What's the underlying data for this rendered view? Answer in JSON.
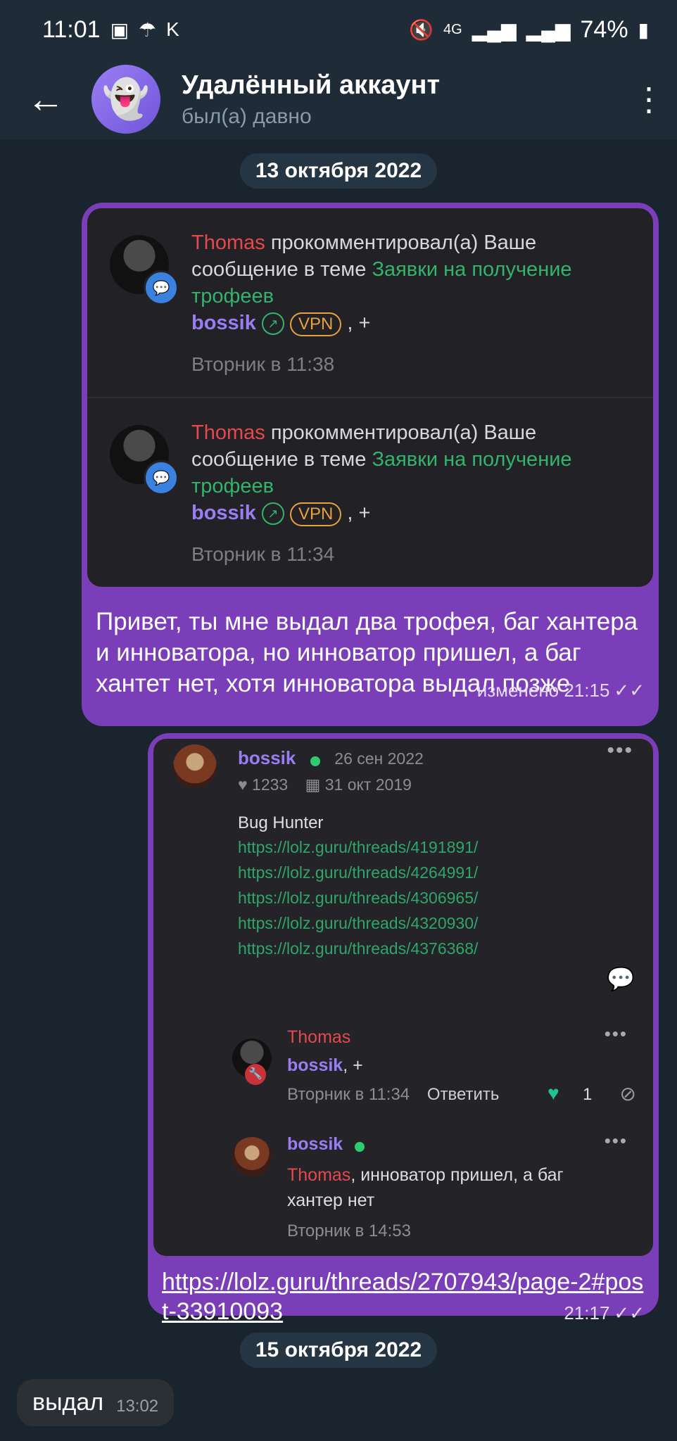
{
  "status_bar": {
    "time": "11:01",
    "left_icons": [
      "image-icon",
      "umbrella-icon",
      "k-icon"
    ],
    "network": "4G",
    "battery": "74%"
  },
  "header": {
    "title": "Удалённый аккаунт",
    "subtitle": "был(а) давно"
  },
  "dates": [
    "13 октября 2022",
    "15 октября 2022"
  ],
  "message1": {
    "notifications": [
      {
        "author": "Thomas",
        "text": "прокомментировал(а) Ваше сообщение в теме",
        "topic": "Заявки на получение трофеев",
        "user": "bossik",
        "badge": "VPN",
        "tail": ", +",
        "time": "Вторник в 11:38"
      },
      {
        "author": "Thomas",
        "text": "прокомментировал(а) Ваше сообщение в теме",
        "topic": "Заявки на получение трофеев",
        "user": "bossik",
        "badge": "VPN",
        "tail": ", +",
        "time": "Вторник в 11:34"
      }
    ],
    "text": "Привет, ты мне выдал два трофея, баг хантера и инноватора, но инноватор пришел, а баг хантет нет, хотя инноватора выдал позже",
    "meta": "изменено 21:15"
  },
  "message2": {
    "post": {
      "user": "bossik",
      "date": "26 сен 2022",
      "likes": "1233",
      "joined": "31 окт 2019",
      "title": "Bug Hunter",
      "links": [
        "https://lolz.guru/threads/4191891/",
        "https://lolz.guru/threads/4264991/",
        "https://lolz.guru/threads/4306965/",
        "https://lolz.guru/threads/4320930/",
        "https://lolz.guru/threads/4376368/"
      ]
    },
    "comments": [
      {
        "author": "Thomas",
        "text_user": "bossik",
        "text": ", +",
        "time": "Вторник в 11:34",
        "reply": "Ответить",
        "likes": "1"
      },
      {
        "author": "bossik",
        "text_user": "Thomas",
        "text": ", инноватор пришел, а баг хантер нет",
        "time": "Вторник в 14:53"
      }
    ],
    "link_text": "https://lolz.guru/threads/2707943/page-2#post-33910093",
    "time": "21:17"
  },
  "message3": {
    "text": "выдал",
    "time": "13:02"
  }
}
